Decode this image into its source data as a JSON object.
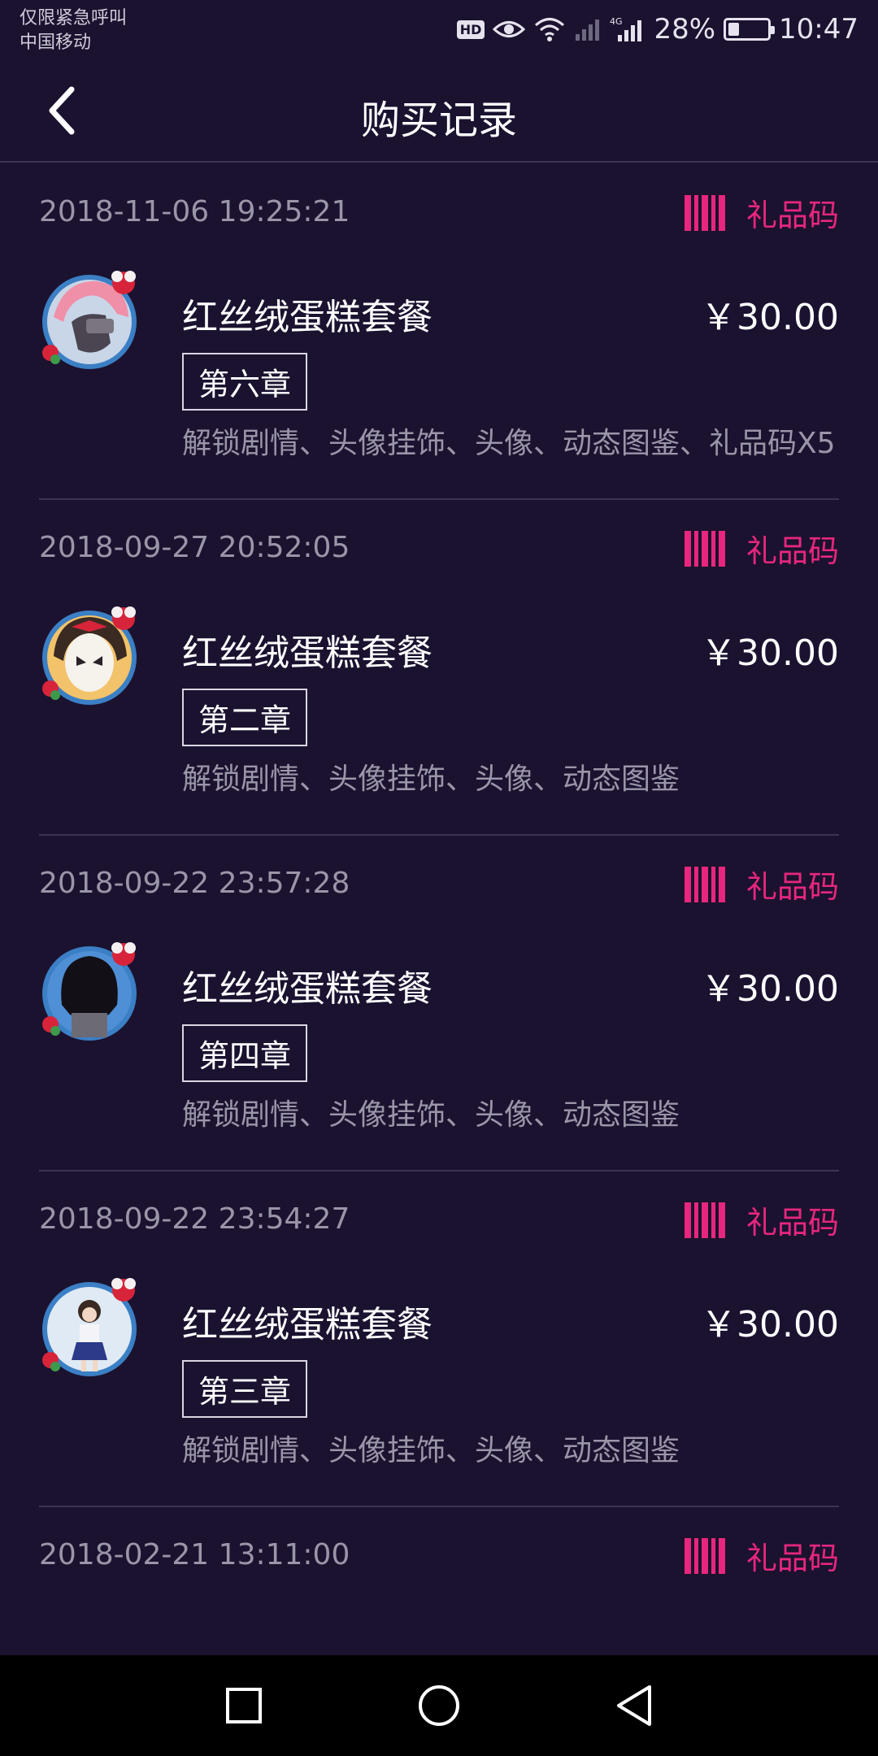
{
  "status_bar": {
    "carrier_line1": "仅限紧急呼叫",
    "carrier_line2": "中国移动",
    "hd": "HD",
    "battery_percent": "28%",
    "battery_level": 0.28,
    "time": "10:47",
    "icons": [
      "eye-icon",
      "wifi-icon",
      "signal-icon",
      "4g-signal-icon",
      "battery-icon"
    ]
  },
  "header": {
    "title": "购买记录",
    "back_icon": "chevron-left-icon"
  },
  "gift_label": "礼品码",
  "colors": {
    "background": "#1b1230",
    "accent": "#e8267f",
    "muted_text": "#9b95a8",
    "divider": "#3c3552"
  },
  "records": [
    {
      "time": "2018-11-06 19:25:21",
      "name": "红丝绒蛋糕套餐",
      "price": "￥30.00",
      "chapter": "第六章",
      "contents": "解锁剧情、头像挂饰、头像、动态图鉴、礼品码X5",
      "avatar": "pink-hair-character-avatar"
    },
    {
      "time": "2018-09-27 20:52:05",
      "name": "红丝绒蛋糕套餐",
      "price": "￥30.00",
      "chapter": "第二章",
      "contents": "解锁剧情、头像挂饰、头像、动态图鉴",
      "avatar": "masked-character-avatar"
    },
    {
      "time": "2018-09-22 23:57:28",
      "name": "红丝绒蛋糕套餐",
      "price": "￥30.00",
      "chapter": "第四章",
      "contents": "解锁剧情、头像挂饰、头像、动态图鉴",
      "avatar": "black-hair-character-avatar"
    },
    {
      "time": "2018-09-22 23:54:27",
      "name": "红丝绒蛋糕套餐",
      "price": "￥30.00",
      "chapter": "第三章",
      "contents": "解锁剧情、头像挂饰、头像、动态图鉴",
      "avatar": "schoolgirl-character-avatar"
    },
    {
      "time": "2018-02-21 13:11:00"
    }
  ],
  "nav_bar": {
    "recent": "square-recent-apps-icon",
    "home": "circle-home-icon",
    "back": "triangle-back-icon"
  }
}
